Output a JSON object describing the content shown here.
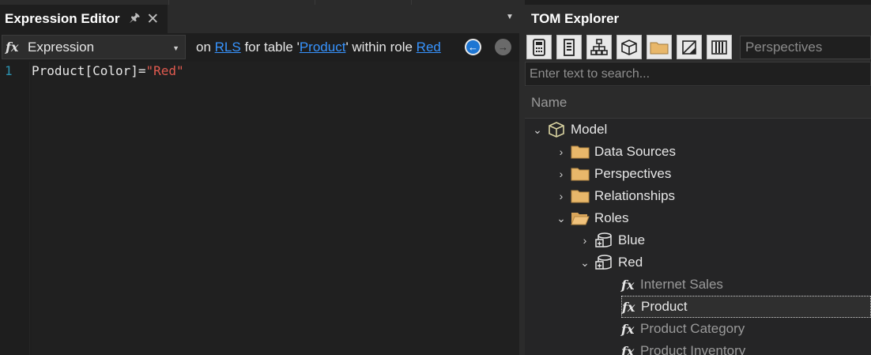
{
  "editor": {
    "tab_title": "Expression Editor",
    "property_selected": "Expression",
    "context": {
      "prefix": "on ",
      "link1": "RLS",
      "middle": " for table '",
      "link2": "Product",
      "middle2": "' within role ",
      "link3": "Red"
    },
    "line_number": "1",
    "code_plain": "Product[Color]=",
    "code_string": "\"Red\""
  },
  "tom": {
    "title": "TOM Explorer",
    "perspectives_placeholder": "Perspectives",
    "search_placeholder": "Enter text to search...",
    "column_header": "Name",
    "toolbar_icons": [
      "calculator-icon",
      "column-list-icon",
      "hierarchy-icon",
      "cube-icon",
      "folder-icon",
      "hidden-icon",
      "columns-icon"
    ],
    "tree": {
      "model": "Model",
      "data_sources": "Data Sources",
      "perspectives": "Perspectives",
      "relationships": "Relationships",
      "roles": "Roles",
      "role_blue": "Blue",
      "role_red": "Red",
      "rls_internet_sales": "Internet Sales",
      "rls_product": "Product",
      "rls_product_category": "Product Category",
      "rls_product_inventory": "Product Inventory"
    }
  },
  "colors": {
    "accent_link": "#3794ff",
    "string_literal": "#e05a4f",
    "line_number": "#2b91af"
  }
}
